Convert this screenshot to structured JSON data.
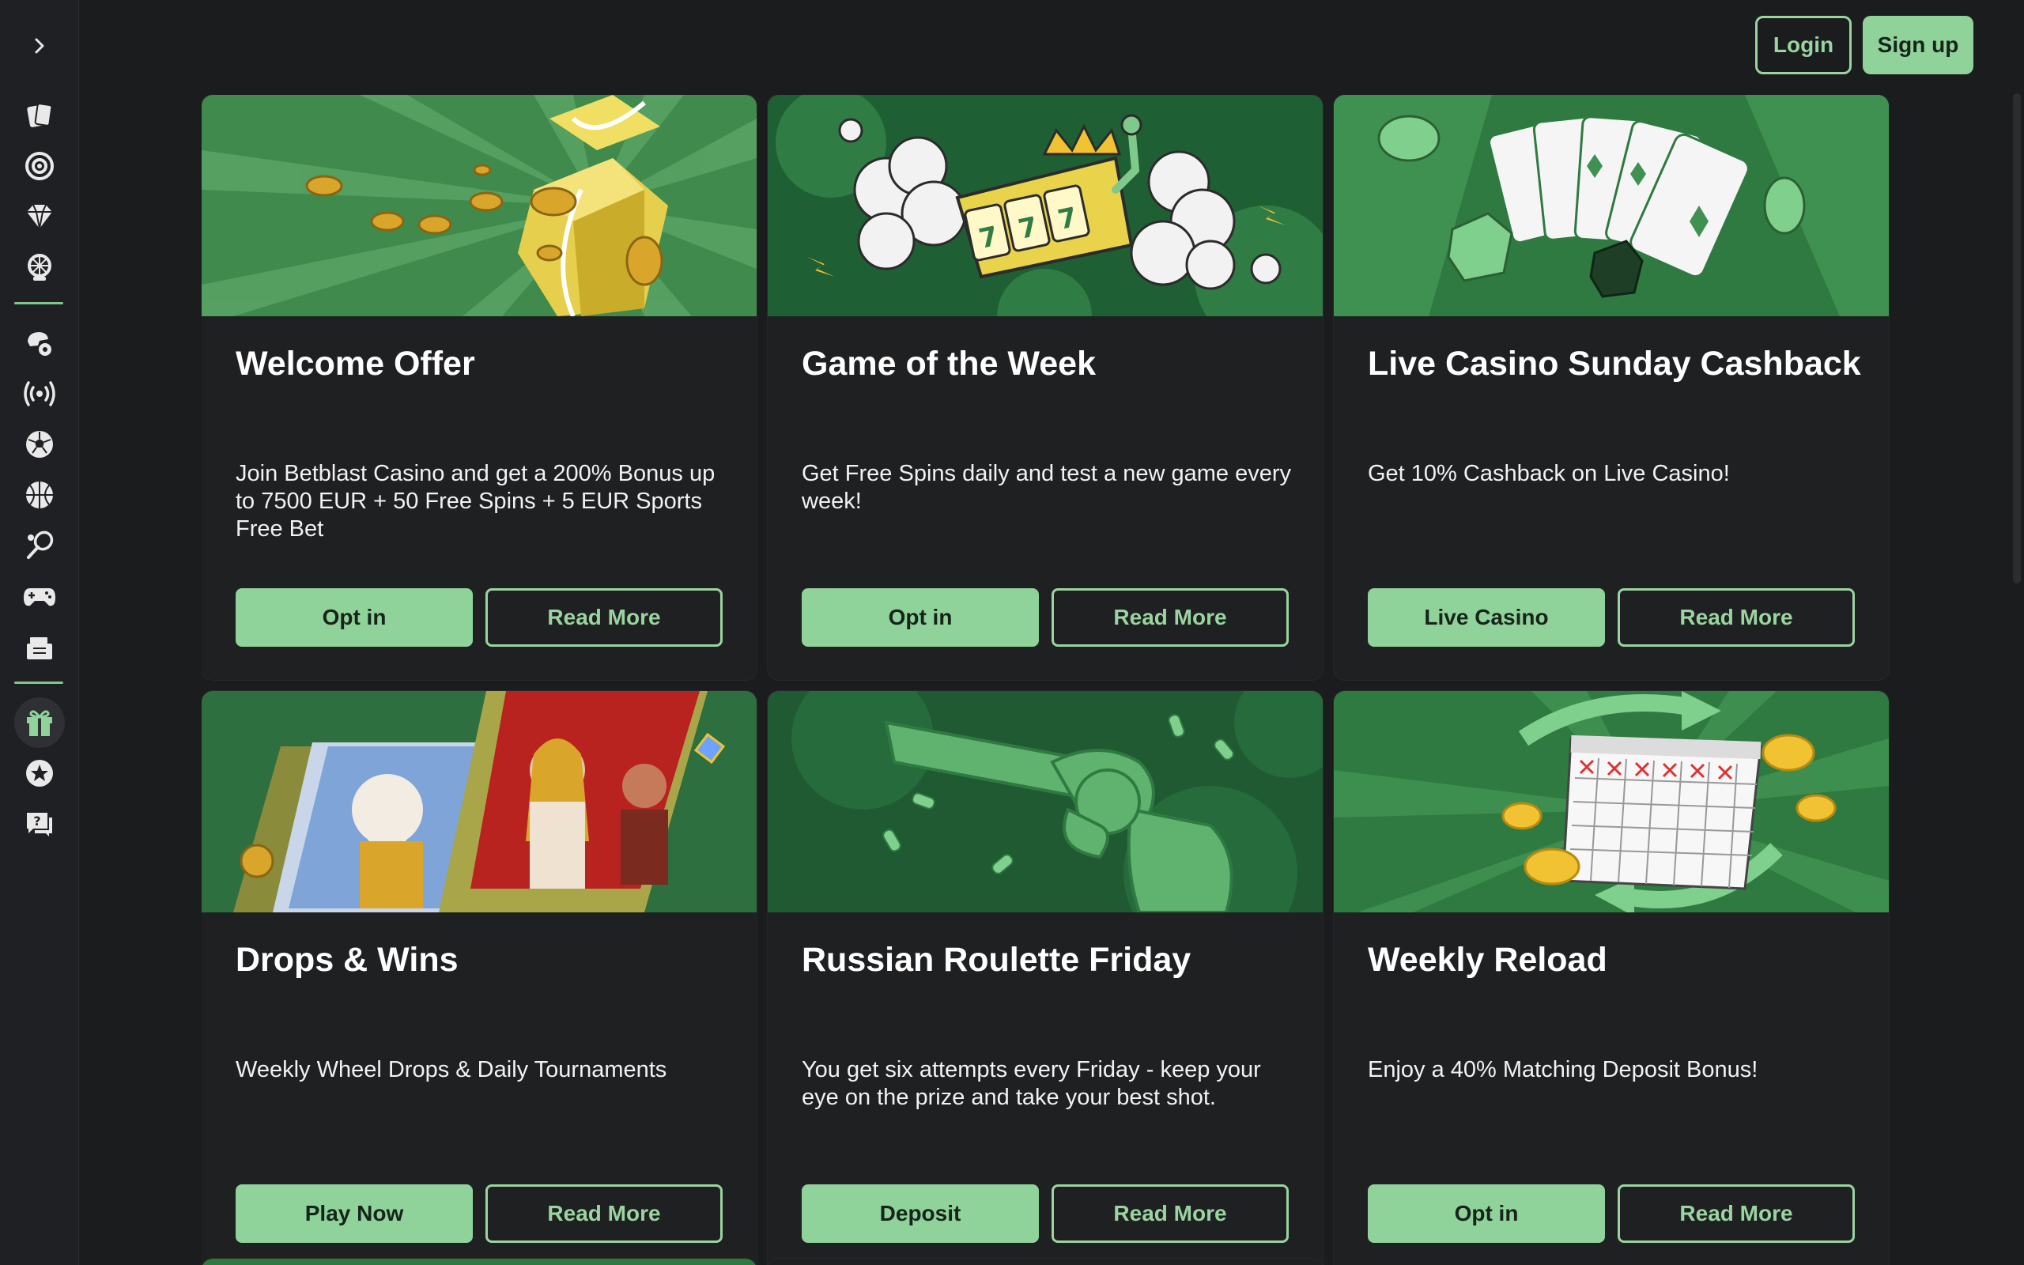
{
  "header": {
    "login_label": "Login",
    "signup_label": "Sign up"
  },
  "sidebar": {
    "items": [
      {
        "icon": "cards-icon"
      },
      {
        "icon": "roulette-icon"
      },
      {
        "icon": "diamond-icon"
      },
      {
        "icon": "wheel-icon"
      },
      {
        "icon": "sports-helmet-ball-icon"
      },
      {
        "icon": "live-broadcast-icon"
      },
      {
        "icon": "soccer-ball-icon"
      },
      {
        "icon": "basketball-icon"
      },
      {
        "icon": "tennis-icon"
      },
      {
        "icon": "gamepad-icon"
      },
      {
        "icon": "tickets-icon"
      },
      {
        "icon": "gift-icon",
        "active": true
      },
      {
        "icon": "star-icon"
      },
      {
        "icon": "help-chat-icon"
      }
    ]
  },
  "colors": {
    "accent": "#8fd39a",
    "background": "#1b1c1e",
    "card": "#1f2022"
  },
  "promotions": [
    {
      "title": "Welcome Offer",
      "description": "Join Betblast Casino and get a 200% Bonus up to 7500 EUR + 50 Free Spins + 5 EUR Sports Free Bet",
      "primary_label": "Opt in",
      "secondary_label": "Read More"
    },
    {
      "title": "Game of the Week",
      "description": "Get Free Spins daily and test a new game every week!",
      "primary_label": "Opt in",
      "secondary_label": "Read More"
    },
    {
      "title": "Live Casino Sunday Cashback",
      "description": "Get 10% Cashback on Live Casino!",
      "primary_label": "Live Casino",
      "secondary_label": "Read More"
    },
    {
      "title": "Drops & Wins",
      "description": "Weekly Wheel Drops & Daily Tournaments",
      "primary_label": "Play Now",
      "secondary_label": "Read More"
    },
    {
      "title": "Russian Roulette Friday",
      "description": "You get six attempts every Friday - keep your eye on the prize and take your best shot.",
      "primary_label": "Deposit",
      "secondary_label": "Read More"
    },
    {
      "title": "Weekly Reload",
      "description": "Enjoy a 40% Matching Deposit Bonus!",
      "primary_label": "Opt in",
      "secondary_label": "Read More"
    }
  ]
}
